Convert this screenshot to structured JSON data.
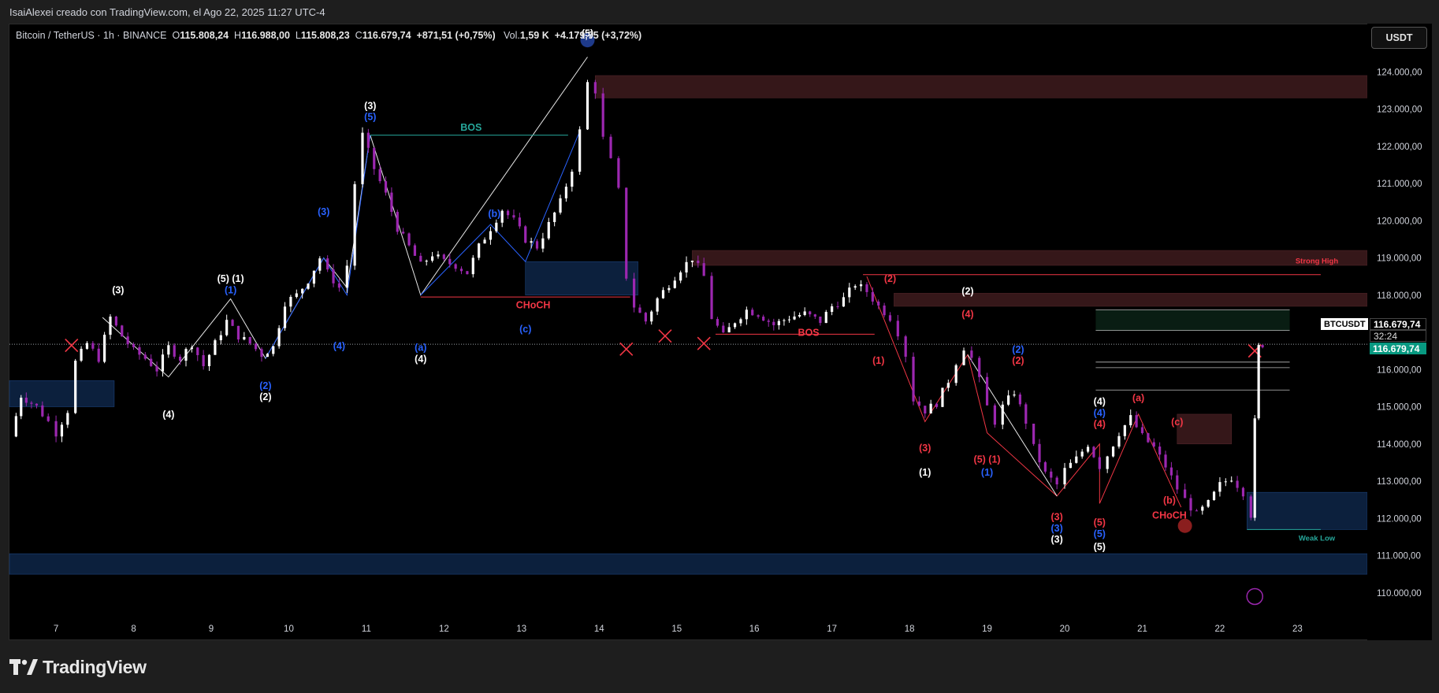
{
  "header": {
    "credit": "IsaiAlexei creado con TradingView.com, el Ago 22, 2025 11:27 UTC-4"
  },
  "legend": {
    "symbol": "Bitcoin / TetherUS · 1h · BINANCE",
    "open_label": "O",
    "open": "115.808,24",
    "high_label": "H",
    "high": "116.988,00",
    "low_label": "L",
    "low": "115.808,23",
    "close_label": "C",
    "close": "116.679,74",
    "change": "+871,51 (+0,75%)",
    "vol_label": "Vol.",
    "volume": "1,59 K",
    "extra": "+4.179,75 (+3,72%)"
  },
  "currency_button": "USDT",
  "price_tags": {
    "symbol": "BTCUSDT",
    "last_price": "116.679,74",
    "countdown": "32:24",
    "line_price": "116.679,74"
  },
  "footer": {
    "brand": "TradingView"
  },
  "colors": {
    "bull": "#ffffff",
    "bear": "#9c27b0",
    "blue_label": "#2962ff",
    "red_label": "#f23645",
    "bos_green": "#26a69a",
    "supply_zone": "#3b1a1c",
    "demand_zone": "#0e2444"
  },
  "chart_data": {
    "type": "candlestick",
    "symbol": "BTCUSDT",
    "timeframe": "1h",
    "exchange": "BINANCE",
    "ylim": [
      109000,
      125000
    ],
    "y_ticks": [
      "110.000,00",
      "111.000,00",
      "112.000,00",
      "113.000,00",
      "114.000,00",
      "115.000,00",
      "116.000,00",
      "117.000,00",
      "118.000,00",
      "119.000,00",
      "120.000,00",
      "121.000,00",
      "122.000,00",
      "123.000,00",
      "124.000,00"
    ],
    "y_tick_values": [
      110000,
      111000,
      112000,
      113000,
      114000,
      115000,
      116000,
      117000,
      118000,
      119000,
      120000,
      121000,
      122000,
      123000,
      124000
    ],
    "xlim": [
      6.4,
      23.9
    ],
    "x_ticks": [
      "7",
      "8",
      "9",
      "10",
      "11",
      "12",
      "13",
      "14",
      "15",
      "16",
      "17",
      "18",
      "19",
      "20",
      "21",
      "22",
      "23"
    ],
    "x_tick_values": [
      7,
      8,
      9,
      10,
      11,
      12,
      13,
      14,
      15,
      16,
      17,
      18,
      19,
      20,
      21,
      22,
      23
    ],
    "price_path": [
      [
        6.42,
        114200
      ],
      [
        6.55,
        115300
      ],
      [
        6.75,
        115000
      ],
      [
        6.9,
        114600
      ],
      [
        7.0,
        114300
      ],
      [
        7.15,
        114900
      ],
      [
        7.25,
        116200
      ],
      [
        7.4,
        116700
      ],
      [
        7.55,
        116300
      ],
      [
        7.7,
        117400
      ],
      [
        7.85,
        116900
      ],
      [
        8.0,
        116500
      ],
      [
        8.15,
        116300
      ],
      [
        8.3,
        116000
      ],
      [
        8.45,
        116600
      ],
      [
        8.6,
        116300
      ],
      [
        8.75,
        116700
      ],
      [
        8.9,
        116100
      ],
      [
        9.05,
        116700
      ],
      [
        9.2,
        117300
      ],
      [
        9.35,
        116900
      ],
      [
        9.5,
        116700
      ],
      [
        9.65,
        116400
      ],
      [
        9.8,
        116600
      ],
      [
        9.95,
        117800
      ],
      [
        10.1,
        118000
      ],
      [
        10.25,
        118400
      ],
      [
        10.4,
        119000
      ],
      [
        10.5,
        118600
      ],
      [
        10.65,
        118200
      ],
      [
        10.75,
        118800
      ],
      [
        10.85,
        121000
      ],
      [
        10.95,
        122300
      ],
      [
        11.1,
        121400
      ],
      [
        11.25,
        120700
      ],
      [
        11.4,
        119800
      ],
      [
        11.55,
        119300
      ],
      [
        11.7,
        118800
      ],
      [
        11.85,
        119100
      ],
      [
        12.0,
        118900
      ],
      [
        12.15,
        118800
      ],
      [
        12.3,
        118600
      ],
      [
        12.45,
        119300
      ],
      [
        12.6,
        119800
      ],
      [
        12.75,
        120300
      ],
      [
        12.9,
        120000
      ],
      [
        13.05,
        119500
      ],
      [
        13.2,
        119300
      ],
      [
        13.35,
        119900
      ],
      [
        13.5,
        120500
      ],
      [
        13.65,
        121400
      ],
      [
        13.75,
        122400
      ],
      [
        13.85,
        123700
      ],
      [
        13.95,
        123500
      ],
      [
        14.05,
        122200
      ],
      [
        14.15,
        121600
      ],
      [
        14.25,
        120800
      ],
      [
        14.35,
        118500
      ],
      [
        14.45,
        117700
      ],
      [
        14.6,
        117300
      ],
      [
        14.75,
        117900
      ],
      [
        14.9,
        118300
      ],
      [
        15.05,
        118700
      ],
      [
        15.2,
        119000
      ],
      [
        15.35,
        118500
      ],
      [
        15.45,
        117400
      ],
      [
        15.6,
        116900
      ],
      [
        15.75,
        117300
      ],
      [
        15.9,
        117600
      ],
      [
        16.05,
        117500
      ],
      [
        16.25,
        117200
      ],
      [
        16.45,
        117400
      ],
      [
        16.65,
        117500
      ],
      [
        16.85,
        117300
      ],
      [
        17.0,
        117700
      ],
      [
        17.15,
        117900
      ],
      [
        17.3,
        118300
      ],
      [
        17.45,
        118100
      ],
      [
        17.6,
        117700
      ],
      [
        17.75,
        117400
      ],
      [
        17.85,
        117000
      ],
      [
        17.95,
        116400
      ],
      [
        18.05,
        115200
      ],
      [
        18.2,
        114900
      ],
      [
        18.35,
        115100
      ],
      [
        18.5,
        115700
      ],
      [
        18.6,
        116200
      ],
      [
        18.7,
        116600
      ],
      [
        18.8,
        116300
      ],
      [
        18.9,
        115700
      ],
      [
        19.0,
        115000
      ],
      [
        19.1,
        114600
      ],
      [
        19.2,
        115000
      ],
      [
        19.35,
        115400
      ],
      [
        19.5,
        114600
      ],
      [
        19.6,
        113900
      ],
      [
        19.75,
        113200
      ],
      [
        19.9,
        112900
      ],
      [
        20.0,
        113300
      ],
      [
        20.15,
        113600
      ],
      [
        20.3,
        114000
      ],
      [
        20.45,
        113400
      ],
      [
        20.55,
        113700
      ],
      [
        20.7,
        114300
      ],
      [
        20.85,
        114700
      ],
      [
        21.0,
        114200
      ],
      [
        21.15,
        113900
      ],
      [
        21.3,
        113400
      ],
      [
        21.45,
        112800
      ],
      [
        21.55,
        112500
      ],
      [
        21.7,
        112100
      ],
      [
        21.85,
        112400
      ],
      [
        22.0,
        112900
      ],
      [
        22.15,
        113100
      ],
      [
        22.3,
        112700
      ],
      [
        22.4,
        112100
      ],
      [
        22.45,
        114600
      ],
      [
        22.5,
        116600
      ],
      [
        22.55,
        116680
      ]
    ],
    "annotations": [
      {
        "text": "(3)",
        "x": 7.8,
        "y": 118050,
        "color": "white"
      },
      {
        "text": "(5) (1)",
        "x": 9.25,
        "y": 118350,
        "color": "white"
      },
      {
        "text": "(1)",
        "x": 9.25,
        "y": 118050,
        "color": "blue"
      },
      {
        "text": "(4)",
        "x": 8.45,
        "y": 114700,
        "color": "white"
      },
      {
        "text": "(2)",
        "x": 9.7,
        "y": 115480,
        "color": "blue"
      },
      {
        "text": "(2)",
        "x": 9.7,
        "y": 115180,
        "color": "white"
      },
      {
        "text": "(3)",
        "x": 10.45,
        "y": 120150,
        "color": "blue"
      },
      {
        "text": "(4)",
        "x": 10.65,
        "y": 116550,
        "color": "blue"
      },
      {
        "text": "(3)",
        "x": 11.05,
        "y": 123000,
        "color": "white"
      },
      {
        "text": "(5)",
        "x": 11.05,
        "y": 122700,
        "color": "blue"
      },
      {
        "text": "(a)",
        "x": 11.7,
        "y": 116500,
        "color": "blue"
      },
      {
        "text": "(4)",
        "x": 11.7,
        "y": 116200,
        "color": "white"
      },
      {
        "text": "(b)",
        "x": 12.65,
        "y": 120100,
        "color": "blue"
      },
      {
        "text": "(c)",
        "x": 13.05,
        "y": 117000,
        "color": "blue"
      },
      {
        "text": "CHoCH",
        "x": 13.15,
        "y": 117650,
        "color": "red"
      },
      {
        "text": "BOS",
        "x": 12.35,
        "y": 122420,
        "color": "green"
      },
      {
        "text": "(5)",
        "x": 13.85,
        "y": 124950,
        "color": "white"
      },
      {
        "text": "(2)",
        "x": 17.75,
        "y": 118350,
        "color": "red"
      },
      {
        "text": "(2)",
        "x": 18.75,
        "y": 118020,
        "color": "white"
      },
      {
        "text": "(4)",
        "x": 18.75,
        "y": 117400,
        "color": "red"
      },
      {
        "text": "(1)",
        "x": 17.6,
        "y": 116150,
        "color": "red"
      },
      {
        "text": "BOS",
        "x": 16.7,
        "y": 116900,
        "color": "red"
      },
      {
        "text": "(3)",
        "x": 18.2,
        "y": 113800,
        "color": "red"
      },
      {
        "text": "(1)",
        "x": 18.2,
        "y": 113150,
        "color": "white"
      },
      {
        "text": "(5) (1)",
        "x": 19.0,
        "y": 113500,
        "color": "red"
      },
      {
        "text": "(1)",
        "x": 19.0,
        "y": 113150,
        "color": "blue"
      },
      {
        "text": "(2)",
        "x": 19.4,
        "y": 116450,
        "color": "blue"
      },
      {
        "text": "(2)",
        "x": 19.4,
        "y": 116150,
        "color": "red"
      },
      {
        "text": "(3)",
        "x": 19.9,
        "y": 111950,
        "color": "red"
      },
      {
        "text": "(3)",
        "x": 19.9,
        "y": 111650,
        "color": "blue"
      },
      {
        "text": "(3)",
        "x": 19.9,
        "y": 111350,
        "color": "white"
      },
      {
        "text": "(4)",
        "x": 20.45,
        "y": 115050,
        "color": "white"
      },
      {
        "text": "(4)",
        "x": 20.45,
        "y": 114750,
        "color": "blue"
      },
      {
        "text": "(4)",
        "x": 20.45,
        "y": 114450,
        "color": "red"
      },
      {
        "text": "(5)",
        "x": 20.45,
        "y": 111800,
        "color": "red"
      },
      {
        "text": "(5)",
        "x": 20.45,
        "y": 111500,
        "color": "blue"
      },
      {
        "text": "(5)",
        "x": 20.45,
        "y": 111150,
        "color": "white"
      },
      {
        "text": "(a)",
        "x": 20.95,
        "y": 115150,
        "color": "red"
      },
      {
        "text": "(c)",
        "x": 21.45,
        "y": 114500,
        "color": "red"
      },
      {
        "text": "(b)",
        "x": 21.35,
        "y": 112400,
        "color": "red"
      },
      {
        "text": "CHoCH",
        "x": 21.35,
        "y": 112000,
        "color": "red"
      },
      {
        "text": "Strong High",
        "x": 23.25,
        "y": 118850,
        "color": "red"
      },
      {
        "text": "Weak Low",
        "x": 23.25,
        "y": 111400,
        "color": "green"
      }
    ],
    "zones": [
      {
        "kind": "supply",
        "x0": 13.95,
        "x1": 23.9,
        "y0": 123300,
        "y1": 123900
      },
      {
        "kind": "supply",
        "x0": 15.2,
        "x1": 23.9,
        "y0": 118800,
        "y1": 119200
      },
      {
        "kind": "supply",
        "x0": 17.8,
        "x1": 23.9,
        "y0": 117700,
        "y1": 118050
      },
      {
        "kind": "supply",
        "x0": 21.45,
        "x1": 22.15,
        "y0": 114000,
        "y1": 114800
      },
      {
        "kind": "demand",
        "x0": 6.4,
        "x1": 7.75,
        "y0": 115000,
        "y1": 115700
      },
      {
        "kind": "demand",
        "x0": 13.05,
        "x1": 14.5,
        "y0": 118000,
        "y1": 118900
      },
      {
        "kind": "demand",
        "x0": 22.35,
        "x1": 23.9,
        "y0": 111700,
        "y1": 112700
      },
      {
        "kind": "demand",
        "x0": 6.4,
        "x1": 23.9,
        "y0": 110500,
        "y1": 111050
      }
    ],
    "last_price": 116679.74,
    "grid": false
  }
}
